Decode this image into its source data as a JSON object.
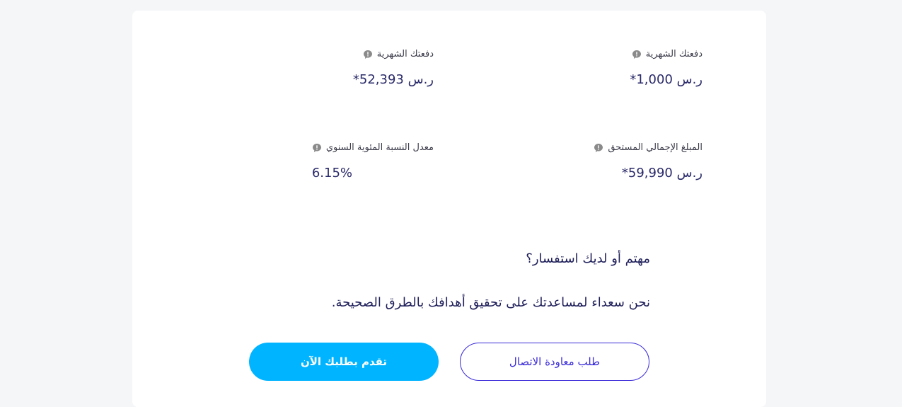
{
  "stats": {
    "monthly_payment_right": {
      "label": "دفعتك الشهرية",
      "value": "ر.س 1,000*"
    },
    "monthly_payment_left": {
      "label": "دفعتك الشهرية",
      "value": "ر.س 52,393*"
    },
    "total_amount": {
      "label": "المبلغ الإجمالي المستحق",
      "value": "ر.س 59,990*"
    },
    "apr": {
      "label": "معدل النسبة المئوية السنوي",
      "value": "6.15%"
    }
  },
  "cta": {
    "title": "مهتم أو لديك استفسار؟",
    "subtitle": "نحن سعداء لمساعدتك على تحقيق أهدافك بالطرق الصحيحة.",
    "callback_button": "طلب معاودة الاتصال",
    "apply_button": "تقدم بطلبك الآن"
  },
  "colors": {
    "primary_button": "#00b4ff",
    "outline_button": "#3a2bd8",
    "text_dark": "#1f1f5a"
  },
  "icons": {
    "info": "info-icon"
  }
}
